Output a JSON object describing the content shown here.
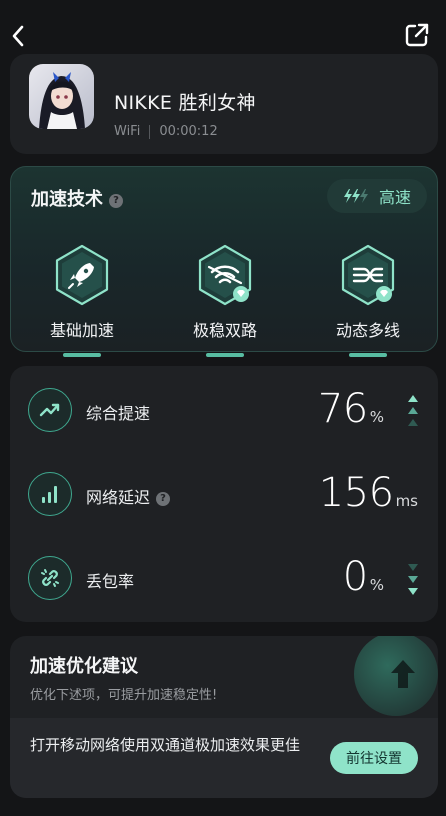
{
  "topbar": {
    "back_icon": "chevron-left-icon",
    "share_icon": "external-link-icon"
  },
  "game": {
    "title": "NIKKE 胜利女神",
    "network": "WiFi",
    "duration": "00:00:12"
  },
  "tech": {
    "title": "加速技术",
    "help": "?",
    "speed_label": "高速",
    "items": [
      {
        "label": "基础加速",
        "icon": "rocket-icon",
        "badge": false
      },
      {
        "label": "极稳双路",
        "icon": "dual-wifi-icon",
        "badge": true
      },
      {
        "label": "动态多线",
        "icon": "multi-line-icon",
        "badge": true
      }
    ]
  },
  "stats": [
    {
      "label": "综合提速",
      "value": "76",
      "unit": "%",
      "icon": "trend-up-icon",
      "trend": "up"
    },
    {
      "label": "网络延迟",
      "value": "156",
      "unit": "ms",
      "icon": "signal-bars-icon",
      "help": "?"
    },
    {
      "label": "丢包率",
      "value": "0",
      "unit": "%",
      "icon": "broken-link-icon",
      "trend": "down"
    }
  ],
  "suggest": {
    "title": "加速优化建议",
    "subtitle": "优化下述项，可提升加速稳定性!",
    "item_text": "打开移动网络使用双通道极加速效果更佳",
    "button": "前往设置"
  },
  "colors": {
    "accent": "#8fe3c9",
    "accent_dark": "#3fa88f",
    "background": "#141517",
    "card": "#1f2124"
  }
}
